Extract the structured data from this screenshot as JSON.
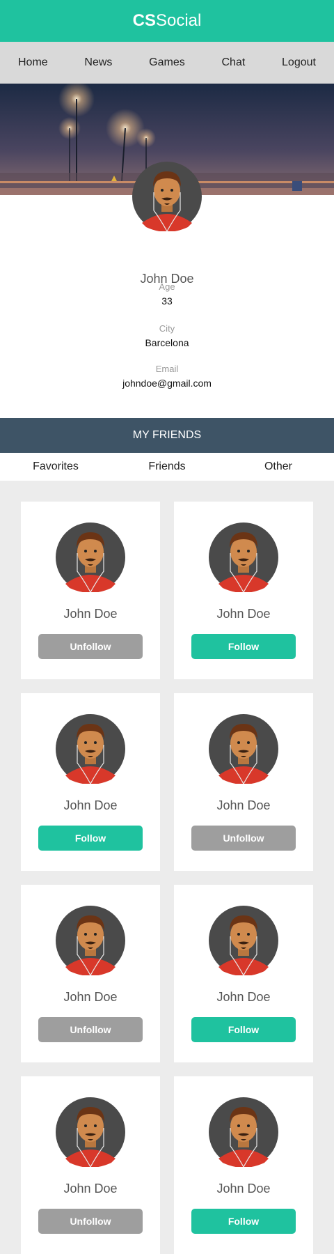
{
  "header": {
    "brand_bold": "CS",
    "brand_rest": "Social"
  },
  "nav": [
    "Home",
    "News",
    "Games",
    "Chat",
    "Logout"
  ],
  "profile": {
    "name": "John Doe",
    "fields": [
      {
        "label": "Age",
        "value": "33"
      },
      {
        "label": "City",
        "value": "Barcelona"
      },
      {
        "label": "Email",
        "value": "johndoe@gmail.com"
      }
    ]
  },
  "friends": {
    "title": "MY FRIENDS",
    "tabs": [
      "Favorites",
      "Friends",
      "Other"
    ],
    "cards": [
      {
        "name": "John Doe",
        "button": "Unfollow",
        "state": "unfollow"
      },
      {
        "name": "John Doe",
        "button": "Follow",
        "state": "follow"
      },
      {
        "name": "John Doe",
        "button": "Follow",
        "state": "follow"
      },
      {
        "name": "John Doe",
        "button": "Unfollow",
        "state": "unfollow"
      },
      {
        "name": "John Doe",
        "button": "Unfollow",
        "state": "unfollow"
      },
      {
        "name": "John Doe",
        "button": "Follow",
        "state": "follow"
      },
      {
        "name": "John Doe",
        "button": "Unfollow",
        "state": "unfollow"
      },
      {
        "name": "John Doe",
        "button": "Follow",
        "state": "follow"
      }
    ]
  },
  "colors": {
    "accent": "#1fc29f",
    "nav_bg": "#d9d9d9",
    "friends_header": "#3e5466",
    "unfollow": "#9e9e9e"
  },
  "icons": {
    "avatar": "avatar-icon",
    "cover": "cover-photo"
  }
}
